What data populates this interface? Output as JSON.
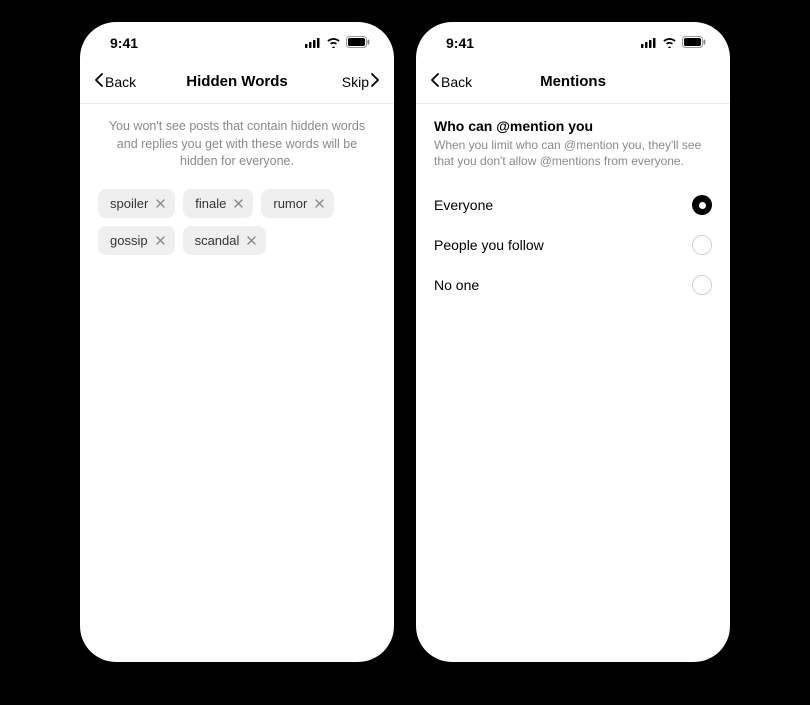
{
  "status": {
    "time": "9:41"
  },
  "left_screen": {
    "nav": {
      "back_label": "Back",
      "title": "Hidden Words",
      "skip_label": "Skip"
    },
    "description": "You won't see posts that contain hidden words and replies you get with these words will be hidden for everyone.",
    "chips": [
      {
        "label": "spoiler"
      },
      {
        "label": "finale"
      },
      {
        "label": "rumor"
      },
      {
        "label": "gossip"
      },
      {
        "label": "scandal"
      }
    ]
  },
  "right_screen": {
    "nav": {
      "back_label": "Back",
      "title": "Mentions"
    },
    "section": {
      "title": "Who can @mention you",
      "description": "When you limit who can @mention you, they'll see that you don't allow @mentions from everyone."
    },
    "options": [
      {
        "label": "Everyone",
        "selected": true
      },
      {
        "label": "People you follow",
        "selected": false
      },
      {
        "label": "No one",
        "selected": false
      }
    ]
  }
}
